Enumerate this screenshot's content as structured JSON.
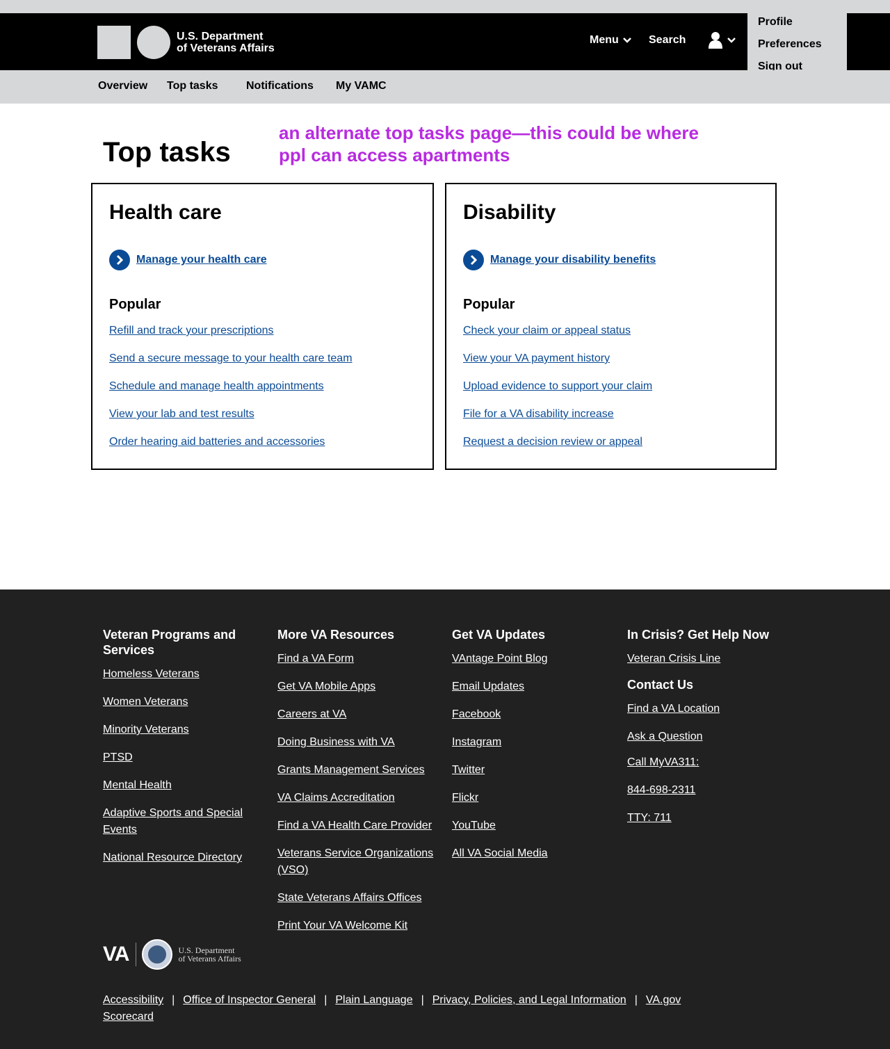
{
  "header": {
    "dept_line1": "U.S. Department",
    "dept_line2": "of Veterans Affairs",
    "menu_label": "Menu",
    "search_label": "Search",
    "user_menu": [
      "Profile",
      "Preferences",
      "Sign out"
    ]
  },
  "subnav": [
    "Overview",
    "Top tasks",
    "Notifications",
    "My VAMC"
  ],
  "page": {
    "title": "Top tasks",
    "annotation": "an alternate top tasks page—this could be where ppl can access apartments"
  },
  "cards": [
    {
      "title": "Health care",
      "primary_link": "Manage your health care",
      "popular_heading": "Popular",
      "links": [
        "Refill and track your prescriptions",
        "Send a secure message to your health care team",
        "Schedule and manage health appointments",
        "View your lab and test results",
        "Order hearing aid batteries and accessories"
      ]
    },
    {
      "title": "Disability",
      "primary_link": "Manage your disability benefits",
      "popular_heading": "Popular",
      "links": [
        "Check your claim or appeal status",
        "View your VA payment history",
        "Upload evidence to support your claim",
        "File for a VA disability increase",
        "Request a decision review or appeal"
      ]
    }
  ],
  "footer": {
    "col1": {
      "heading": "Veteran Programs and Services",
      "links": [
        "Homeless Veterans",
        "Women Veterans",
        "Minority Veterans",
        "PTSD",
        "Mental Health",
        "Adaptive Sports and Special Events",
        "National Resource Directory"
      ]
    },
    "col2": {
      "heading": "More VA Resources",
      "links": [
        "Find a VA Form",
        "Get VA Mobile Apps",
        "Careers at VA",
        "Doing Business with VA",
        "Grants Management Services",
        "VA Claims Accreditation",
        "Find a VA Health Care Provider",
        "Veterans Service Organizations (VSO)",
        "State Veterans Affairs Offices",
        "Print Your VA Welcome Kit"
      ]
    },
    "col3": {
      "heading": "Get VA Updates",
      "links": [
        "VAntage Point Blog",
        "Email Updates",
        "Facebook",
        "Instagram",
        "Twitter",
        "Flickr",
        "YouTube",
        "All VA Social Media"
      ]
    },
    "col4": {
      "heading": "In Crisis? Get Help Now",
      "links": [
        "Veteran Crisis Line"
      ],
      "heading2": "Contact Us",
      "links2": [
        "Find a VA Location",
        "Ask a Question",
        "Call MyVA311:",
        "844-698-2311",
        "TTY: 711"
      ]
    },
    "logo": {
      "letters": "VA",
      "dept_line1": "U.S. Department",
      "dept_line2": "of Veterans Affairs"
    },
    "bottom_links": [
      "Accessibility",
      "Office of Inspector General",
      "Plain Language",
      "Privacy, Policies, and Legal Information",
      "VA.gov Scorecard"
    ],
    "separator": "|"
  }
}
